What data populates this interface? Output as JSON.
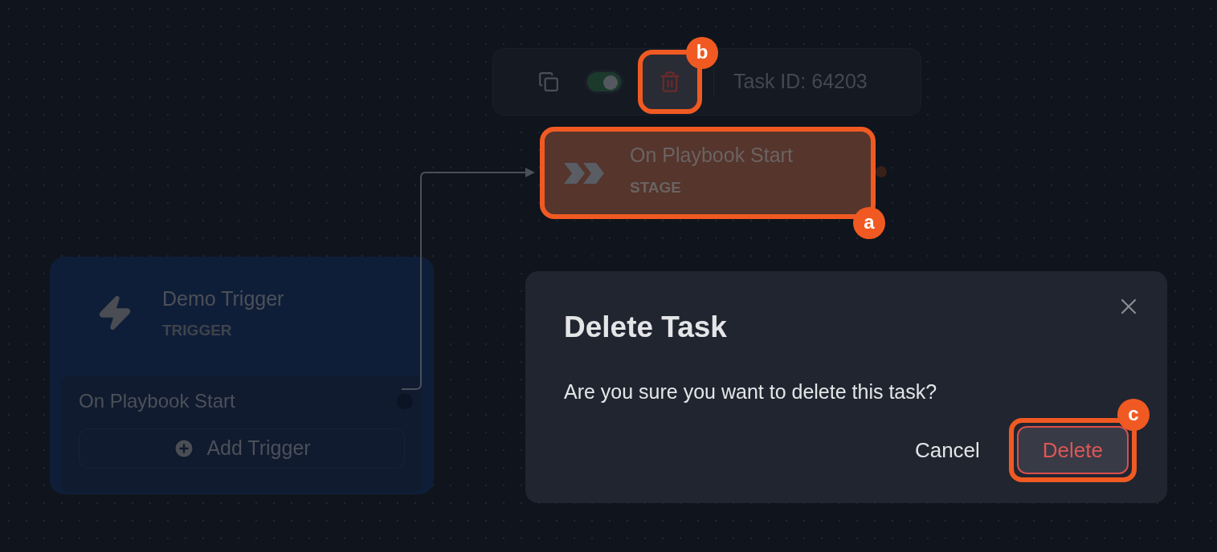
{
  "toolbar": {
    "toggle": {
      "on": true
    },
    "delete_callout": "b",
    "task_id": "Task ID: 64203"
  },
  "stage_node": {
    "title": "On Playbook Start",
    "subtitle": "STAGE",
    "callout": "a"
  },
  "trigger_node": {
    "title": "Demo Trigger",
    "subtitle": "TRIGGER",
    "triggers": [
      "On Playbook Start"
    ],
    "add_button": "Add Trigger"
  },
  "dialog": {
    "title": "Delete Task",
    "message": "Are you sure you want to delete this task?",
    "buttons": [
      {
        "label": "Cancel",
        "kind": "secondary"
      },
      {
        "label": "Delete",
        "kind": "danger",
        "callout": "c"
      }
    ]
  }
}
